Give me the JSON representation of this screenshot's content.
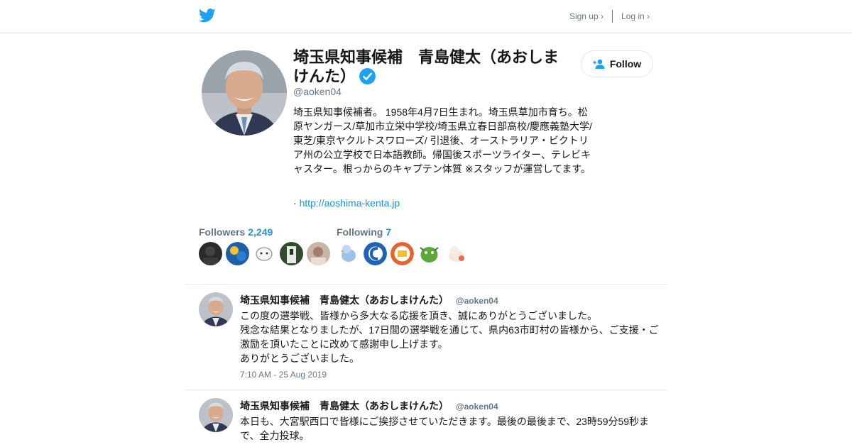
{
  "nav": {
    "signup_label": "Sign up ›",
    "login_label": "Log in ›"
  },
  "profile": {
    "name": "埼玉県知事候補　青島健太（あおしまけんた）",
    "handle": "@aoken04",
    "follow_label": "Follow",
    "bio": "埼玉県知事候補者。 1958年4月7日生まれ。埼玉県草加市育ち。松原ヤンガース/草加市立栄中学校/埼玉県立春日部高校/慶應義塾大学/東芝/東京ヤクルトスワローズ/ 引退後、オーストラリア・ビクトリア州の公立学校で日本語教師。帰国後スポーツライター、テレビキャスター。根っからのキャプテン体質 ※スタッフが運営してます。",
    "url_prefix": "·",
    "url": "http://aoshima-kenta.jp"
  },
  "stats": {
    "followers_label": "Followers",
    "followers_count": "2,249",
    "following_label": "Following",
    "following_count": "7"
  },
  "tweets": [
    {
      "name": "埼玉県知事候補　青島健太（あおしまけんた）",
      "handle": "@aoken04",
      "lines": [
        "この度の選挙戦、皆様から多大なる応援を頂き、誠にありがとうございました。",
        "残念な結果となりましたが、17日間の選挙戦を通じて、県内63市町村の皆様から、ご支援・ご激励を頂いたことに改めて感謝申し上げます。",
        "ありがとうございました。"
      ],
      "time": "7:10 AM - 25 Aug 2019"
    },
    {
      "name": "埼玉県知事候補　青島健太（あおしまけんた）",
      "handle": "@aoken04",
      "lines": [
        "本日も、大宮駅西口で皆様にご挨拶させていただきます。最後の最後まで、23時59分59秒まで、全力投球。"
      ],
      "time": ""
    }
  ],
  "colors": {
    "accent": "#1b95e0",
    "twitter_blue": "#1da1f2",
    "muted": "#657786"
  }
}
